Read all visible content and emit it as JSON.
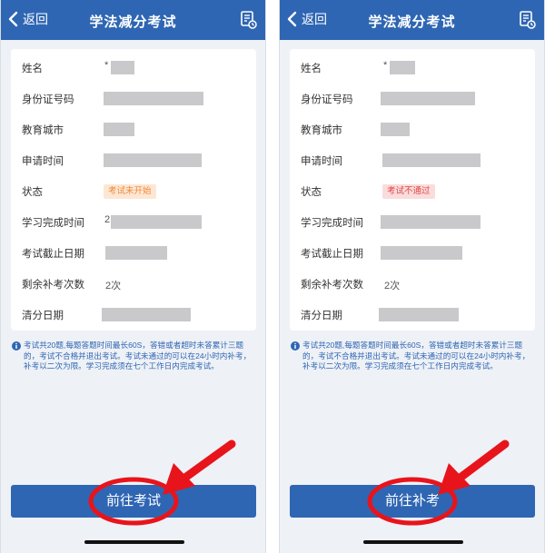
{
  "screens": [
    {
      "nav": {
        "back_label": "返回",
        "title": "学法减分考试"
      },
      "fields": [
        {
          "label": "姓名",
          "prefix": "*"
        },
        {
          "label": "身份证号码"
        },
        {
          "label": "教育城市"
        },
        {
          "label": "申请时间"
        },
        {
          "label": "状态",
          "badge": "考试未开始"
        },
        {
          "label": "学习完成时间",
          "prefix": "2"
        },
        {
          "label": "考试截止日期"
        },
        {
          "label": "剩余补考次数",
          "value": "2次"
        },
        {
          "label": "清分日期"
        }
      ],
      "notice": "考试共20题,每题答题时间最长60S，答错或者超时未答累计三题的，考试不合格并退出考试。考试未通过的可以在24小时内补考，补考以二次为限。学习完成须在七个工作日内完成考试。",
      "button_label": "前往考试"
    },
    {
      "nav": {
        "back_label": "返回",
        "title": "学法减分考试"
      },
      "fields": [
        {
          "label": "姓名",
          "prefix": "*"
        },
        {
          "label": "身份证号码"
        },
        {
          "label": "教育城市"
        },
        {
          "label": "申请时间"
        },
        {
          "label": "状态",
          "badge": "考试不通过"
        },
        {
          "label": "学习完成时间"
        },
        {
          "label": "考试截止日期"
        },
        {
          "label": "剩余补考次数",
          "value": "2次"
        },
        {
          "label": "清分日期"
        }
      ],
      "notice": "考试共20题,每题答题时间最长60S，答错或者超时未答累计三题的，考试不合格并退出考试。考试未通过的可以在24小时内补考，补考以二次为限。学习完成须在七个工作日内完成考试。",
      "button_label": "前往补考"
    }
  ],
  "colors": {
    "nav_bg": "#2f66b3",
    "button_bg": "#2f66b3",
    "page_bg": "#eef1f6",
    "badge_not_started_bg": "#fde7d4",
    "badge_not_started_text": "#f08a3a",
    "badge_failed_bg": "#fbdcdc",
    "badge_failed_text": "#e04848",
    "annotation": "#e8141b",
    "redaction": "#c9c9cb"
  }
}
